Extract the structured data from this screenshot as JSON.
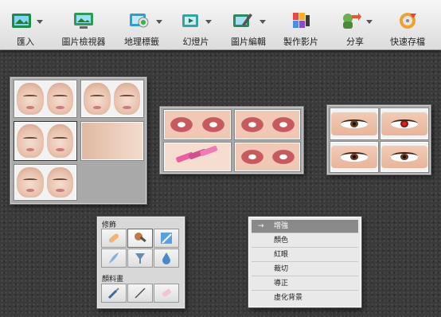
{
  "toolbar": {
    "items": [
      {
        "label": "匯入",
        "icon": "import-icon",
        "dropdown": true
      },
      {
        "label": "圖片檢視器",
        "icon": "image-viewer-icon",
        "dropdown": false
      },
      {
        "label": "地理標籤",
        "icon": "geotag-icon",
        "dropdown": true
      },
      {
        "label": "幻燈片",
        "icon": "slideshow-icon",
        "dropdown": true
      },
      {
        "label": "圖片編輯",
        "icon": "image-edit-icon",
        "dropdown": true
      },
      {
        "label": "製作影片",
        "icon": "make-video-icon",
        "dropdown": false
      },
      {
        "label": "分享",
        "icon": "share-icon",
        "dropdown": true
      },
      {
        "label": "快速存檔",
        "icon": "quick-save-icon",
        "dropdown": false
      }
    ]
  },
  "palette": {
    "retouch_title": "修飾",
    "paint_title": "顏料畫",
    "retouch_tools": [
      "bandage-icon",
      "makeup-brush-icon",
      "magic-wand-icon",
      "feather-icon",
      "funnel-icon",
      "drop-icon"
    ],
    "paint_tools": [
      "paintbrush-icon",
      "pencil-icon",
      "eraser-icon"
    ]
  },
  "menu": {
    "items": [
      {
        "label": "增強",
        "active": true
      },
      {
        "label": "顏色",
        "active": false
      },
      {
        "label": "紅眼",
        "active": false
      },
      {
        "label": "裁切",
        "active": false
      },
      {
        "label": "導正",
        "active": false
      },
      {
        "label": "虛化背景",
        "active": false
      }
    ],
    "check_mark": "→"
  },
  "colors": {
    "toolbar_top": "#f7f7f7",
    "toolbar_bottom": "#dcdcdc",
    "panel": "#a9a9a9",
    "menu_active": "#8a8a8a"
  }
}
